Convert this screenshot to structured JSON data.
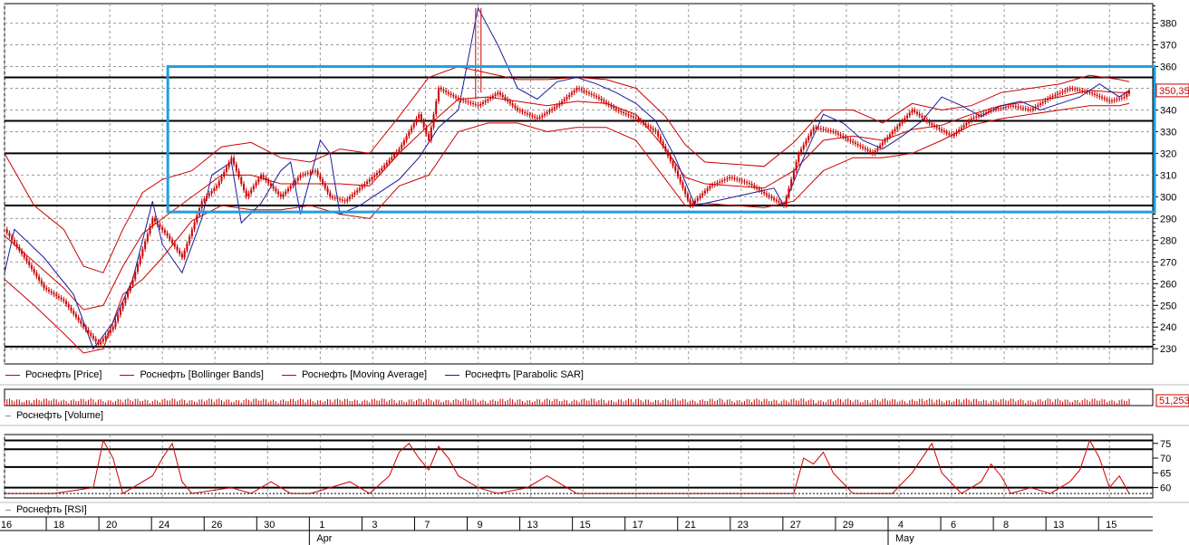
{
  "legend": {
    "items": [
      {
        "label": "Роснефть [Price]",
        "color": "#cc0000"
      },
      {
        "label": "Роснефть [Bollinger Bands]",
        "color": "#cc0000"
      },
      {
        "label": "Роснефть [Moving Average]",
        "color": "#cc0000"
      },
      {
        "label": "Роснефть [Parabolic SAR]",
        "color": "#1a1aa0"
      }
    ]
  },
  "volume_label": "Роснефть [Volume]",
  "rsi_label": "Роснефть [RSI]",
  "last_price_label": "350,35",
  "last_volume_label": "51,253",
  "colors": {
    "candle": "#cc0000",
    "sar": "#1a1aa0",
    "highlight": "#1ea0e0",
    "grid": "#999999"
  },
  "chart_data": [
    {
      "type": "line",
      "name": "price",
      "y_ticks": [
        230,
        240,
        250,
        260,
        270,
        280,
        290,
        300,
        310,
        320,
        330,
        340,
        350,
        360,
        370,
        380
      ],
      "ylim": [
        223,
        389
      ],
      "x_tick_labels": [
        "16",
        "18",
        "20",
        "24",
        "26",
        "30",
        "1",
        "3",
        "7",
        "9",
        "13",
        "15",
        "17",
        "21",
        "23",
        "27",
        "29",
        "4",
        "6",
        "8",
        "13",
        "15"
      ],
      "month_labels": [
        {
          "label": "Apr",
          "at": "1"
        },
        {
          "label": "May",
          "at": "4"
        }
      ],
      "levels": [
        231,
        296,
        320,
        335,
        355
      ],
      "highlight_box": {
        "y_top": 360,
        "y_bottom": 293,
        "from_session": "24"
      },
      "close": [
        [
          0,
          285
        ],
        [
          4,
          272
        ],
        [
          8,
          258
        ],
        [
          12,
          252
        ],
        [
          16,
          240
        ],
        [
          19,
          232
        ],
        [
          22,
          240
        ],
        [
          26,
          262
        ],
        [
          30,
          290
        ],
        [
          33,
          282
        ],
        [
          36,
          272
        ],
        [
          40,
          298
        ],
        [
          43,
          305
        ],
        [
          46,
          318
        ],
        [
          49,
          300
        ],
        [
          52,
          310
        ],
        [
          56,
          300
        ],
        [
          60,
          310
        ],
        [
          63,
          312
        ],
        [
          66,
          300
        ],
        [
          69,
          298
        ],
        [
          73,
          306
        ],
        [
          76,
          312
        ],
        [
          80,
          322
        ],
        [
          84,
          338
        ],
        [
          86,
          326
        ],
        [
          88,
          350
        ],
        [
          92,
          345
        ],
        [
          96,
          342
        ],
        [
          100,
          348
        ],
        [
          104,
          340
        ],
        [
          108,
          336
        ],
        [
          112,
          342
        ],
        [
          116,
          350
        ],
        [
          120,
          346
        ],
        [
          124,
          340
        ],
        [
          128,
          336
        ],
        [
          132,
          330
        ],
        [
          136,
          312
        ],
        [
          139,
          296
        ],
        [
          143,
          305
        ],
        [
          147,
          309
        ],
        [
          151,
          306
        ],
        [
          155,
          300
        ],
        [
          158,
          296
        ],
        [
          161,
          320
        ],
        [
          164,
          332
        ],
        [
          168,
          330
        ],
        [
          172,
          325
        ],
        [
          176,
          320
        ],
        [
          180,
          330
        ],
        [
          184,
          340
        ],
        [
          188,
          333
        ],
        [
          192,
          328
        ],
        [
          196,
          336
        ],
        [
          200,
          340
        ],
        [
          204,
          342
        ],
        [
          208,
          340
        ],
        [
          212,
          346
        ],
        [
          216,
          350
        ],
        [
          220,
          348
        ],
        [
          224,
          344
        ],
        [
          227,
          346
        ],
        [
          228,
          349
        ]
      ],
      "bollinger_upper": [
        [
          0,
          320
        ],
        [
          6,
          296
        ],
        [
          12,
          285
        ],
        [
          16,
          268
        ],
        [
          20,
          265
        ],
        [
          24,
          285
        ],
        [
          28,
          302
        ],
        [
          32,
          308
        ],
        [
          38,
          312
        ],
        [
          44,
          323
        ],
        [
          50,
          325
        ],
        [
          56,
          318
        ],
        [
          62,
          316
        ],
        [
          68,
          322
        ],
        [
          74,
          320
        ],
        [
          80,
          337
        ],
        [
          86,
          355
        ],
        [
          92,
          360
        ],
        [
          98,
          357
        ],
        [
          104,
          354
        ],
        [
          110,
          354
        ],
        [
          116,
          355
        ],
        [
          122,
          354
        ],
        [
          128,
          350
        ],
        [
          134,
          337
        ],
        [
          138,
          324
        ],
        [
          142,
          316
        ],
        [
          148,
          315
        ],
        [
          154,
          314
        ],
        [
          160,
          325
        ],
        [
          166,
          340
        ],
        [
          172,
          340
        ],
        [
          178,
          334
        ],
        [
          184,
          343
        ],
        [
          190,
          340
        ],
        [
          196,
          342
        ],
        [
          202,
          348
        ],
        [
          208,
          350
        ],
        [
          214,
          352
        ],
        [
          220,
          356
        ],
        [
          226,
          354
        ],
        [
          228,
          353
        ]
      ],
      "bollinger_lower": [
        [
          0,
          262
        ],
        [
          6,
          250
        ],
        [
          12,
          237
        ],
        [
          16,
          228
        ],
        [
          20,
          230
        ],
        [
          24,
          255
        ],
        [
          28,
          262
        ],
        [
          32,
          272
        ],
        [
          38,
          289
        ],
        [
          44,
          296
        ],
        [
          50,
          294
        ],
        [
          56,
          294
        ],
        [
          62,
          296
        ],
        [
          68,
          292
        ],
        [
          74,
          290
        ],
        [
          80,
          305
        ],
        [
          86,
          310
        ],
        [
          92,
          330
        ],
        [
          98,
          334
        ],
        [
          104,
          334
        ],
        [
          110,
          330
        ],
        [
          116,
          332
        ],
        [
          122,
          332
        ],
        [
          128,
          326
        ],
        [
          134,
          308
        ],
        [
          138,
          296
        ],
        [
          142,
          297
        ],
        [
          148,
          296
        ],
        [
          154,
          295
        ],
        [
          160,
          298
        ],
        [
          166,
          312
        ],
        [
          172,
          318
        ],
        [
          178,
          318
        ],
        [
          184,
          320
        ],
        [
          190,
          326
        ],
        [
          196,
          333
        ],
        [
          202,
          336
        ],
        [
          208,
          338
        ],
        [
          214,
          340
        ],
        [
          220,
          342
        ],
        [
          226,
          342
        ],
        [
          228,
          343
        ]
      ],
      "moving_average": [
        [
          0,
          282
        ],
        [
          6,
          270
        ],
        [
          12,
          258
        ],
        [
          16,
          248
        ],
        [
          20,
          250
        ],
        [
          24,
          268
        ],
        [
          28,
          283
        ],
        [
          32,
          290
        ],
        [
          38,
          300
        ],
        [
          44,
          310
        ],
        [
          50,
          310
        ],
        [
          56,
          306
        ],
        [
          62,
          306
        ],
        [
          68,
          306
        ],
        [
          74,
          305
        ],
        [
          80,
          320
        ],
        [
          86,
          333
        ],
        [
          92,
          345
        ],
        [
          98,
          346
        ],
        [
          104,
          344
        ],
        [
          110,
          342
        ],
        [
          116,
          344
        ],
        [
          122,
          343
        ],
        [
          128,
          338
        ],
        [
          134,
          322
        ],
        [
          138,
          309
        ],
        [
          142,
          306
        ],
        [
          148,
          305
        ],
        [
          154,
          304
        ],
        [
          160,
          312
        ],
        [
          166,
          326
        ],
        [
          172,
          328
        ],
        [
          178,
          326
        ],
        [
          184,
          331
        ],
        [
          190,
          333
        ],
        [
          196,
          338
        ],
        [
          202,
          342
        ],
        [
          208,
          344
        ],
        [
          214,
          346
        ],
        [
          220,
          349
        ],
        [
          226,
          348
        ],
        [
          228,
          348
        ]
      ],
      "parabolic_sar": [
        [
          0,
          265
        ],
        [
          2,
          285
        ],
        [
          8,
          272
        ],
        [
          14,
          255
        ],
        [
          18,
          230
        ],
        [
          22,
          242
        ],
        [
          26,
          262
        ],
        [
          30,
          298
        ],
        [
          32,
          278
        ],
        [
          36,
          265
        ],
        [
          40,
          290
        ],
        [
          42,
          310
        ],
        [
          46,
          316
        ],
        [
          48,
          288
        ],
        [
          52,
          297
        ],
        [
          56,
          312
        ],
        [
          58,
          316
        ],
        [
          60,
          292
        ],
        [
          64,
          326
        ],
        [
          66,
          320
        ],
        [
          68,
          292
        ],
        [
          72,
          296
        ],
        [
          76,
          302
        ],
        [
          80,
          308
        ],
        [
          84,
          318
        ],
        [
          88,
          332
        ],
        [
          92,
          340
        ],
        [
          96,
          387
        ],
        [
          100,
          370
        ],
        [
          104,
          350
        ],
        [
          108,
          345
        ],
        [
          112,
          353
        ],
        [
          116,
          355
        ],
        [
          120,
          352
        ],
        [
          124,
          348
        ],
        [
          128,
          343
        ],
        [
          132,
          335
        ],
        [
          136,
          318
        ],
        [
          140,
          296
        ],
        [
          144,
          298
        ],
        [
          148,
          300
        ],
        [
          152,
          302
        ],
        [
          156,
          304
        ],
        [
          158,
          296
        ],
        [
          162,
          318
        ],
        [
          166,
          338
        ],
        [
          170,
          334
        ],
        [
          174,
          326
        ],
        [
          178,
          322
        ],
        [
          182,
          328
        ],
        [
          186,
          335
        ],
        [
          190,
          346
        ],
        [
          194,
          342
        ],
        [
          198,
          337
        ],
        [
          202,
          342
        ],
        [
          206,
          344
        ],
        [
          210,
          340
        ],
        [
          214,
          343
        ],
        [
          218,
          346
        ],
        [
          222,
          352
        ],
        [
          226,
          346
        ],
        [
          228,
          349
        ]
      ]
    },
    {
      "type": "bar",
      "name": "volume",
      "last_value": 51.253
    },
    {
      "type": "line",
      "name": "RSI",
      "y_ticks": [
        60,
        65,
        70,
        75
      ],
      "levels": [
        60,
        67,
        73,
        76
      ],
      "values": [
        [
          0,
          58
        ],
        [
          10,
          58
        ],
        [
          14,
          59
        ],
        [
          18,
          60
        ],
        [
          20,
          76
        ],
        [
          22,
          70
        ],
        [
          24,
          58
        ],
        [
          30,
          64
        ],
        [
          32,
          70
        ],
        [
          34,
          75
        ],
        [
          36,
          62
        ],
        [
          38,
          58
        ],
        [
          46,
          60
        ],
        [
          50,
          58
        ],
        [
          54,
          62
        ],
        [
          58,
          58
        ],
        [
          62,
          58
        ],
        [
          66,
          60
        ],
        [
          70,
          62
        ],
        [
          74,
          58
        ],
        [
          78,
          64
        ],
        [
          80,
          72
        ],
        [
          82,
          75
        ],
        [
          84,
          70
        ],
        [
          86,
          66
        ],
        [
          88,
          74
        ],
        [
          90,
          70
        ],
        [
          92,
          64
        ],
        [
          96,
          60
        ],
        [
          100,
          58
        ],
        [
          106,
          60
        ],
        [
          110,
          64
        ],
        [
          112,
          62
        ],
        [
          116,
          58
        ],
        [
          130,
          58
        ],
        [
          150,
          58
        ],
        [
          160,
          58
        ],
        [
          162,
          70
        ],
        [
          164,
          68
        ],
        [
          166,
          72
        ],
        [
          168,
          65
        ],
        [
          172,
          58
        ],
        [
          180,
          58
        ],
        [
          184,
          65
        ],
        [
          186,
          70
        ],
        [
          188,
          75
        ],
        [
          190,
          65
        ],
        [
          194,
          58
        ],
        [
          198,
          62
        ],
        [
          200,
          68
        ],
        [
          202,
          64
        ],
        [
          204,
          58
        ],
        [
          208,
          60
        ],
        [
          212,
          58
        ],
        [
          216,
          62
        ],
        [
          218,
          66
        ],
        [
          220,
          76
        ],
        [
          222,
          70
        ],
        [
          224,
          60
        ],
        [
          226,
          64
        ],
        [
          228,
          58
        ]
      ]
    }
  ]
}
